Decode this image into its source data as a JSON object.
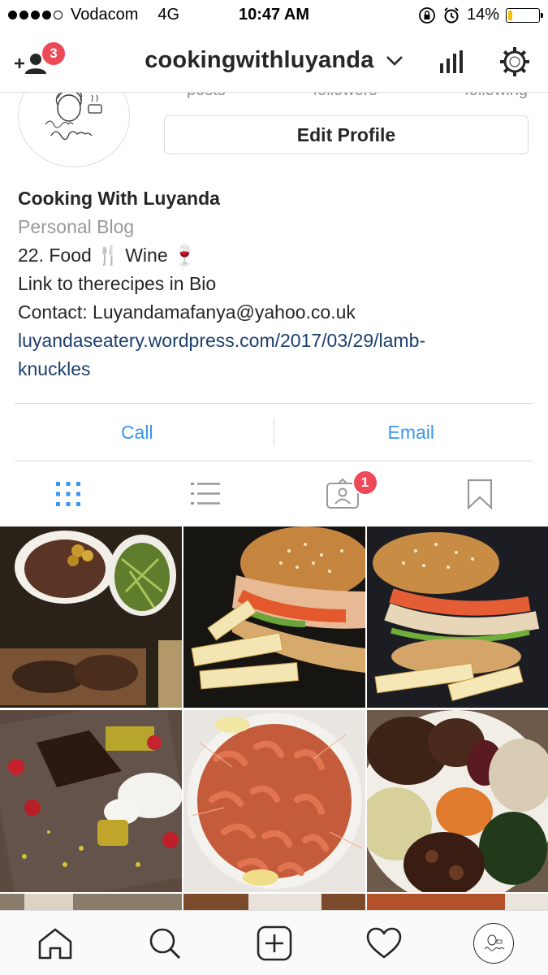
{
  "status_bar": {
    "carrier": "Vodacom",
    "network": "4G",
    "time": "10:47 AM",
    "battery_percent": "14%",
    "battery_level": 0.14,
    "signal_bars": 4
  },
  "header": {
    "username": "cookingwithluyanda",
    "follow_requests_badge": "3"
  },
  "profile": {
    "avatar_caption": "Cooking with Luyanda",
    "stat_labels": [
      "posts",
      "followers",
      "following"
    ],
    "edit_profile_label": "Edit Profile",
    "display_name": "Cooking With Luyanda",
    "category": "Personal Blog",
    "bio_lines": [
      "22. Food 🍴 Wine 🍷",
      "Link to therecipes in Bio",
      "Contact: Luyandamafanya@yahoo.co.uk"
    ],
    "website_line1": "luyandaseatery.wordpress.com/2017/03/29/lamb-",
    "website_line2": "knuckles"
  },
  "contact_buttons": {
    "call": "Call",
    "email": "Email"
  },
  "tabs": {
    "tagged_badge": "1"
  },
  "colors": {
    "link_blue": "#3897f0",
    "website_blue": "#1c3f6e",
    "badge_red": "#ed4956",
    "border": "#dbdbdb",
    "muted": "#8e8e8e"
  },
  "icons": [
    "add-user-icon",
    "chevron-down-icon",
    "stats-icon",
    "settings-gear-icon",
    "grid-icon",
    "list-icon",
    "tagged-icon",
    "bookmark-icon",
    "home-icon",
    "search-icon",
    "new-post-icon",
    "heart-icon",
    "profile-icon"
  ]
}
